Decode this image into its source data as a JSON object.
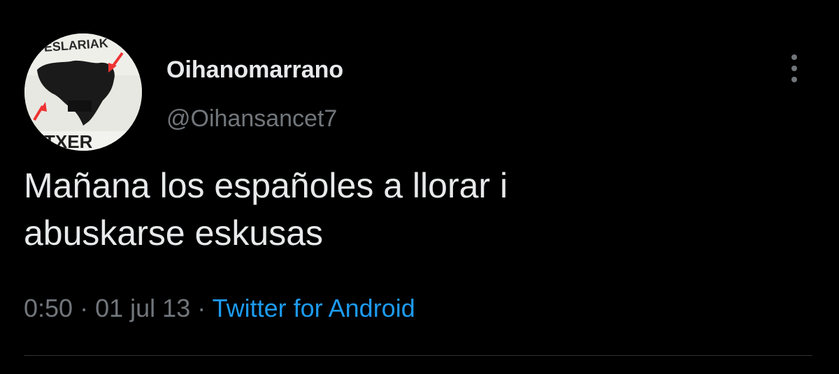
{
  "tweet": {
    "author": {
      "display_name": "Oihanomarrano",
      "handle": "@Oihansancet7",
      "avatar_text": {
        "top": "ESLARIAK",
        "bottom": "TXER"
      }
    },
    "text_lines": [
      "Mañana los españoles a llorar i",
      "abuskarse eskusas"
    ],
    "meta": {
      "time": "0:50",
      "separator": "·",
      "date": "01 jul 13",
      "source": "Twitter for Android"
    }
  },
  "colors": {
    "background": "#000000",
    "primary_text": "#e7e9ea",
    "secondary_text": "#71767b",
    "link": "#1d9bf0",
    "divider": "#2f3336"
  },
  "icons": {
    "more": "more-vertical-icon"
  }
}
